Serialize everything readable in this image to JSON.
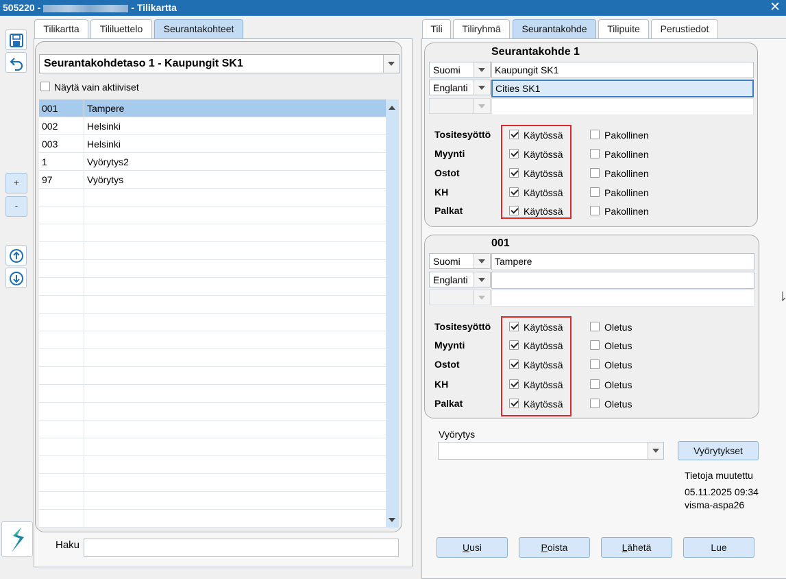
{
  "window": {
    "title_prefix": "505220 -",
    "title_suffix": "- Tilikartta",
    "close_glyph": "✕"
  },
  "toolbar": {
    "icons": [
      "save-icon",
      "undo-icon",
      "plus",
      "minus",
      "arrow-up-icon",
      "arrow-down-icon",
      "visma-logo-icon"
    ],
    "plus_label": "+",
    "minus_label": "-"
  },
  "left_tabs": [
    {
      "label": "Tilikartta",
      "active": false
    },
    {
      "label": "Tililuettelo",
      "active": false
    },
    {
      "label": "Seurantakohteet",
      "active": true
    }
  ],
  "left_panel": {
    "level_select": "Seurantakohdetaso 1 - Kaupungit SK1",
    "show_active_label": "Näytä vain aktiiviset",
    "show_active_checked": false,
    "rows": [
      {
        "code": "001",
        "name": "Tampere",
        "selected": true
      },
      {
        "code": "002",
        "name": "Helsinki",
        "selected": false
      },
      {
        "code": "003",
        "name": "Helsinki",
        "selected": false
      },
      {
        "code": "1",
        "name": "Vyörytys2",
        "selected": false
      },
      {
        "code": "97",
        "name": "Vyörytys",
        "selected": false
      }
    ],
    "search_label": "Haku",
    "search_value": ""
  },
  "right_tabs": [
    {
      "label": "Tili",
      "active": false
    },
    {
      "label": "Tiliryhmä",
      "active": false
    },
    {
      "label": "Seurantakohde",
      "active": true
    },
    {
      "label": "Tilipuite",
      "active": false
    },
    {
      "label": "Perustiedot",
      "active": false
    }
  ],
  "group1": {
    "heading": "Seurantakohde 1",
    "langs": [
      {
        "lang": "Suomi",
        "value": "Kaupungit SK1"
      },
      {
        "lang": "Englanti",
        "value": "Cities SK1"
      },
      {
        "lang": "",
        "value": ""
      }
    ],
    "flags": [
      {
        "label": "Tositesyöttö",
        "enabled_label": "Käytössä",
        "enabled": true,
        "mandatory_label": "Pakollinen",
        "mandatory": false
      },
      {
        "label": "Myynti",
        "enabled_label": "Käytössä",
        "enabled": true,
        "mandatory_label": "Pakollinen",
        "mandatory": false
      },
      {
        "label": "Ostot",
        "enabled_label": "Käytössä",
        "enabled": true,
        "mandatory_label": "Pakollinen",
        "mandatory": false
      },
      {
        "label": "KH",
        "enabled_label": "Käytössä",
        "enabled": true,
        "mandatory_label": "Pakollinen",
        "mandatory": false
      },
      {
        "label": "Palkat",
        "enabled_label": "Käytössä",
        "enabled": true,
        "mandatory_label": "Pakollinen",
        "mandatory": false
      }
    ]
  },
  "group2": {
    "heading": "001",
    "langs": [
      {
        "lang": "Suomi",
        "value": "Tampere"
      },
      {
        "lang": "Englanti",
        "value": ""
      },
      {
        "lang": "",
        "value": ""
      }
    ],
    "flags": [
      {
        "label": "Tositesyöttö",
        "enabled_label": "Käytössä",
        "enabled": true,
        "default_label": "Oletus",
        "default": false
      },
      {
        "label": "Myynti",
        "enabled_label": "Käytössä",
        "enabled": true,
        "default_label": "Oletus",
        "default": false
      },
      {
        "label": "Ostot",
        "enabled_label": "Käytössä",
        "enabled": true,
        "default_label": "Oletus",
        "default": false
      },
      {
        "label": "KH",
        "enabled_label": "Käytössä",
        "enabled": true,
        "default_label": "Oletus",
        "default": false
      },
      {
        "label": "Palkat",
        "enabled_label": "Käytössä",
        "enabled": true,
        "default_label": "Oletus",
        "default": false
      }
    ]
  },
  "allocation": {
    "label": "Vyörytys",
    "value": "",
    "button": "Vyörytykset"
  },
  "modified": {
    "label": "Tietoja muutettu",
    "timestamp": "05.11.2025 09:34",
    "user": "visma-aspa26"
  },
  "actions": {
    "new_accel": "U",
    "new_rest": "usi",
    "delete_accel": "P",
    "delete_rest": "oista",
    "send_accel": "L",
    "send_rest": "ähetä",
    "read": "Lue"
  },
  "colors": {
    "titlebar": "#1f6fb2",
    "selected_row": "#a7cbed",
    "active_tab": "#c4dcf3",
    "highlight_box": "#e0272f"
  }
}
